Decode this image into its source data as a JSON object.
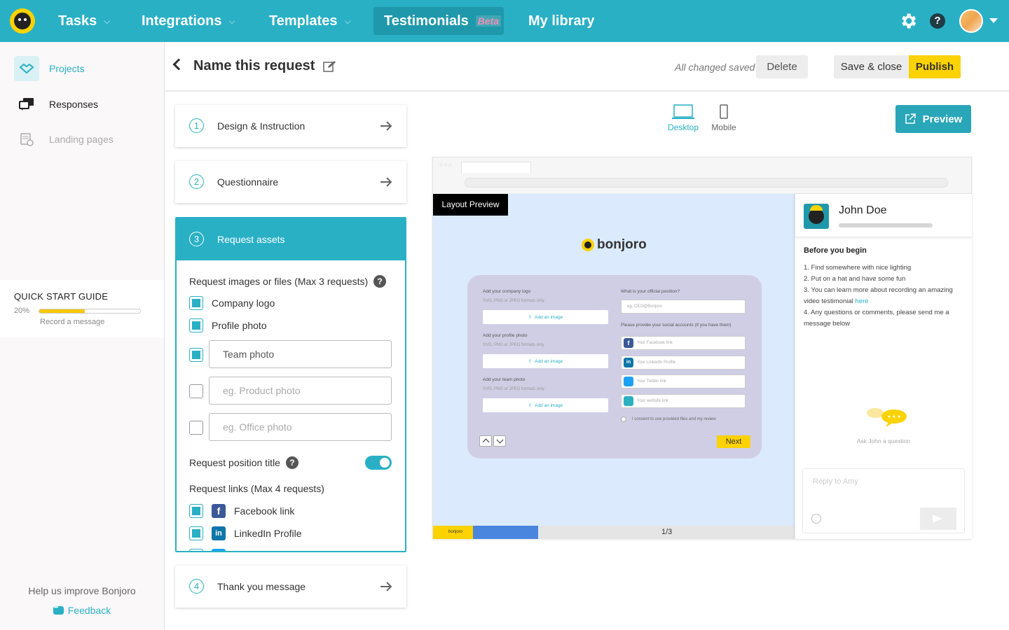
{
  "colors": {
    "brand": "#29b0c5",
    "accent": "#fcd200",
    "nav_active": "#1f98ab"
  },
  "topnav": {
    "items": [
      {
        "label": "Tasks"
      },
      {
        "label": "Integrations"
      },
      {
        "label": "Templates"
      },
      {
        "label": "Testimonials",
        "badge": "Beta"
      },
      {
        "label": "My library"
      }
    ],
    "icons": [
      "logo-icon",
      "gear-icon",
      "help-icon",
      "avatar",
      "chevron-down-icon"
    ]
  },
  "sidebar": {
    "items": [
      {
        "label": "Projects"
      },
      {
        "label": "Responses"
      },
      {
        "label": "Landing pages"
      }
    ],
    "quick_start": {
      "title": "QUICK START GUIDE",
      "percent_label": "20%",
      "progress": 0.45,
      "subtitle": "Record a message"
    },
    "help_text": "Help us improve Bonjoro",
    "feedback": "Feedback"
  },
  "header": {
    "title": "Name this request",
    "saved_status": "All changed saved",
    "delete": "Delete",
    "save_close": "Save & close",
    "publish": "Publish"
  },
  "steps": [
    {
      "num": "1",
      "label": "Design & Instruction"
    },
    {
      "num": "2",
      "label": "Questionnaire"
    },
    {
      "num": "3",
      "label": "Request assets"
    },
    {
      "num": "4",
      "label": "Thank you message"
    }
  ],
  "assets": {
    "images_title": "Request images or files (Max 3 requests)",
    "images": [
      {
        "label": "Company logo",
        "checked": true
      },
      {
        "label": "Profile photo",
        "checked": true
      }
    ],
    "team_input": "Team photo",
    "product_placeholder": "eg. Product photo",
    "office_placeholder": "eg. Office photo",
    "position_title": "Request position title",
    "links_title": "Request links (Max 4 requests)",
    "links": [
      {
        "label": "Facebook link",
        "checked": true
      },
      {
        "label": "LinkedIn Profile",
        "checked": true
      }
    ]
  },
  "preview_toolbar": {
    "desktop": "Desktop",
    "mobile": "Mobile",
    "preview": "Preview"
  },
  "preview": {
    "layout_tag": "Layout Preview",
    "brand": "bonjoro",
    "form": {
      "company_logo": "Add your company logo",
      "formats": "SVG, PNG or JPEG formats only",
      "add_image": "Add an image",
      "profile_photo": "Add your profile photo",
      "team_photo": "Add your team photo",
      "position_q": "What is your official position?",
      "position_ph": "eg. CEO@Bonjoro",
      "social_q": "Please provide your social accounts (if you have them)",
      "facebook_ph": "Your Facebook link",
      "linkedin_ph": "Your LinkedIn Profile",
      "twitter_ph": "Your Twitter link",
      "website_ph": "Your website link",
      "consent": "I consent to use provided files and my review",
      "next": "Next"
    },
    "pager": "1/3",
    "pager_brand": "bonjoro",
    "chat": {
      "name": "John Doe",
      "before_title": "Before you begin",
      "items": [
        "1. Find somewhere with nice lighting",
        "2. Put on a hat and have some fun",
        "3. You can learn more about recording an amazing video testimonial",
        "4. Any questions or comments, please send me a message below"
      ],
      "link_text": "here",
      "ask": "Ask John  a question",
      "reply_ph": "Reply to Amy"
    }
  }
}
